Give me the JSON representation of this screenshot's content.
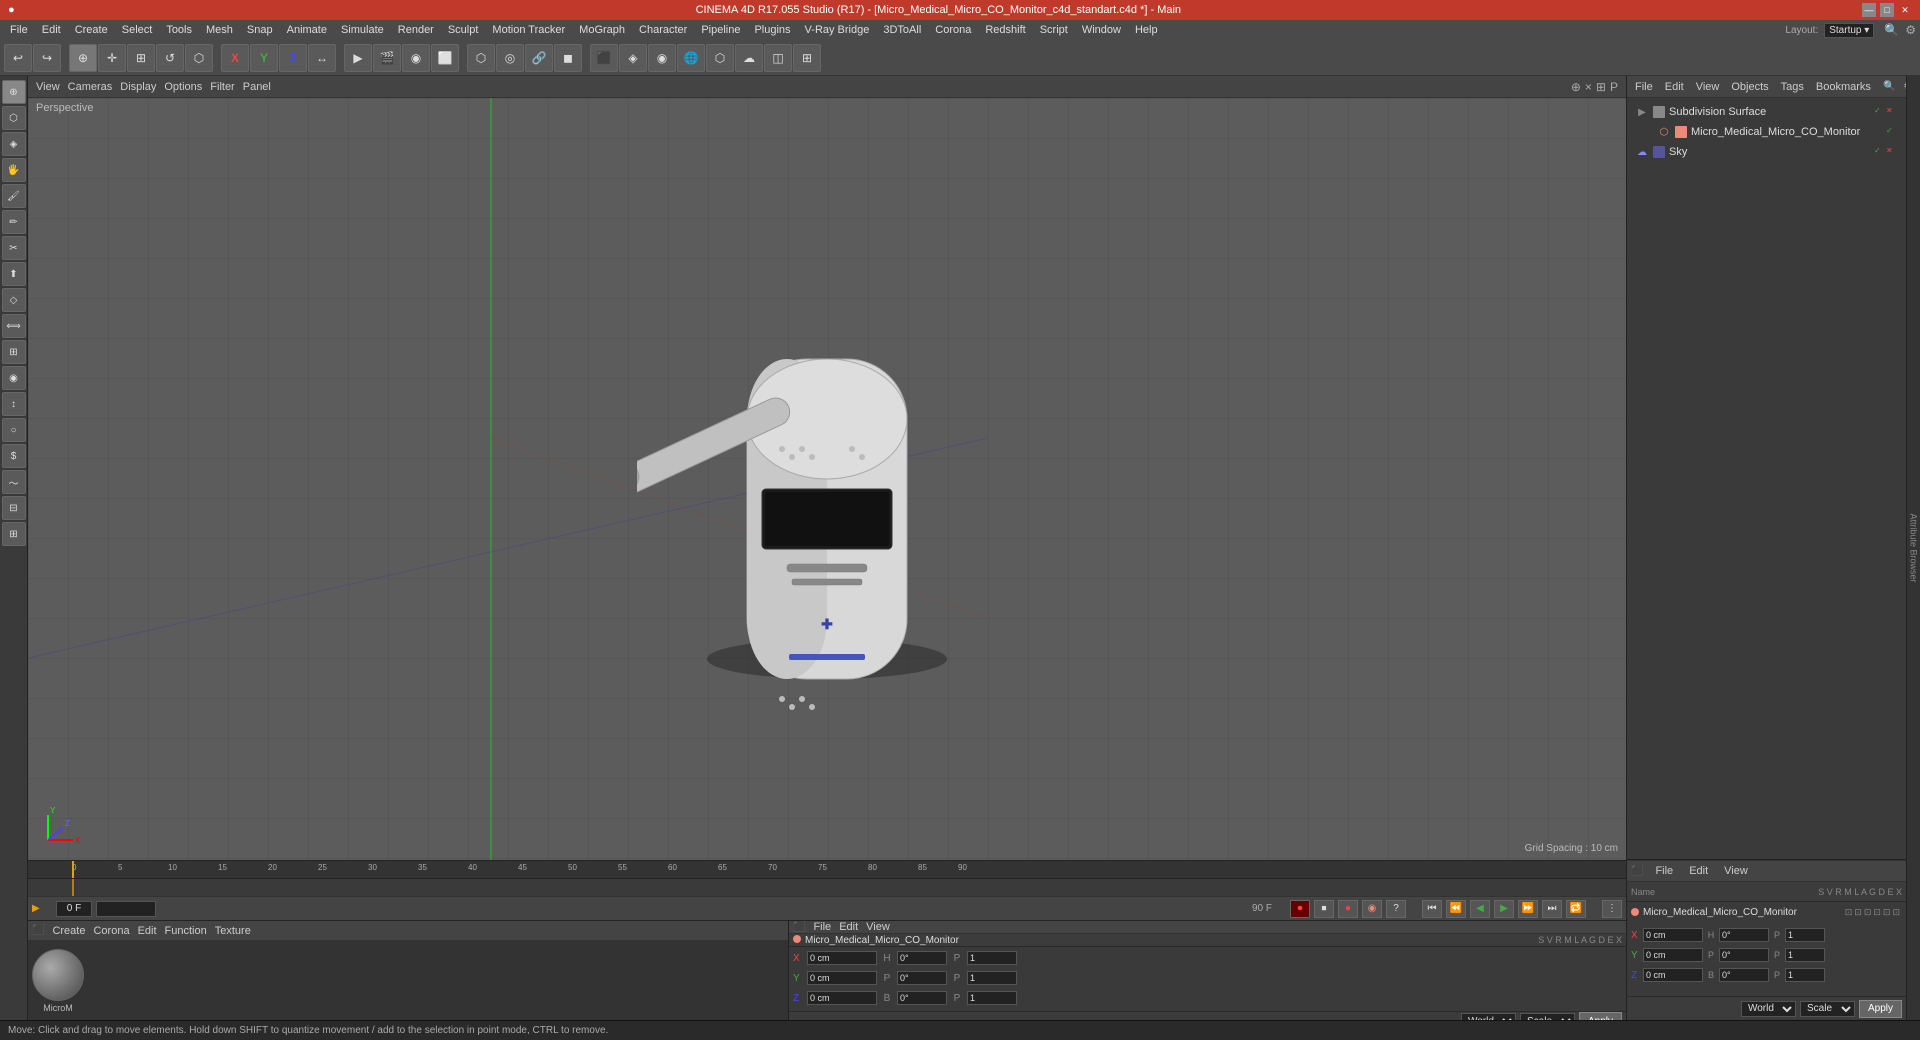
{
  "titleBar": {
    "title": "CINEMA 4D R17.055 Studio (R17) - [Micro_Medical_Micro_CO_Monitor_c4d_standart.c4d *] - Main",
    "minimize": "—",
    "maximize": "□",
    "close": "✕"
  },
  "menuBar": {
    "items": [
      "File",
      "Edit",
      "Create",
      "Select",
      "Tools",
      "Mesh",
      "Snap",
      "Animate",
      "Simulate",
      "Render",
      "Sculpt",
      "Motion Tracker",
      "MoGraph",
      "Character",
      "Pipeline",
      "Plugins",
      "V-Ray Bridge",
      "3DToAll",
      "Corona",
      "Redshift",
      "Script",
      "Window",
      "Help"
    ]
  },
  "toolbar": {
    "layout_label": "Layout:",
    "layout_value": "Startup",
    "groups": [
      {
        "id": "undo",
        "buttons": [
          "↩",
          "↪"
        ]
      },
      {
        "id": "mode",
        "buttons": [
          "⊕",
          "☰",
          "◎",
          "○",
          "⊡",
          "⬡"
        ]
      },
      {
        "id": "transform",
        "buttons": [
          "X",
          "Y",
          "Z",
          "↔"
        ]
      },
      {
        "id": "render",
        "buttons": [
          "▶",
          "🎬",
          "◉",
          "⬜",
          "◼",
          "🔘",
          "⚙",
          "🌐",
          "⬡",
          "◫",
          "⬛"
        ]
      },
      {
        "id": "tools",
        "buttons": [
          "⬡",
          "◎",
          "🌀",
          "⚙",
          "◈",
          "◉",
          "🔲",
          "⬛"
        ]
      }
    ]
  },
  "viewport": {
    "menus": [
      "View",
      "Cameras",
      "Display",
      "Options",
      "Filter",
      "Panel"
    ],
    "perspectiveLabel": "Perspective",
    "gridSpacing": "Grid Spacing : 10 cm",
    "controls": [
      "+",
      "×",
      "⊞",
      "P"
    ]
  },
  "sceneTree": {
    "header_menus": [
      "File",
      "Edit",
      "View",
      "Objects",
      "Tags",
      "Bookmarks"
    ],
    "items": [
      {
        "id": "subdivision",
        "label": "Subdivision Surface",
        "indent": 0,
        "color": "green",
        "checked": true,
        "xmark": true
      },
      {
        "id": "monitor",
        "label": "Micro_Medical_Micro_CO_Monitor",
        "indent": 1,
        "color": "orange",
        "checked": true,
        "xmark": false
      },
      {
        "id": "sky",
        "label": "Sky",
        "indent": 0,
        "color": "blue",
        "checked": true,
        "xmark": true
      }
    ]
  },
  "timeline": {
    "header_menus": [],
    "markers": [
      "0",
      "50",
      "100",
      "150",
      "200",
      "250",
      "300",
      "350",
      "400",
      "450",
      "500",
      "550",
      "600",
      "650",
      "700",
      "750",
      "800",
      "850",
      "900"
    ],
    "ruler_labels": [
      "0",
      "5",
      "10",
      "15",
      "20",
      "25",
      "30",
      "35",
      "40",
      "45",
      "50",
      "55",
      "60",
      "65",
      "70",
      "75",
      "80",
      "85",
      "90"
    ],
    "currentFrame": "0 F",
    "startFrame": "0 F",
    "endFrame": "90 F"
  },
  "transport": {
    "frameStart": "0",
    "frameCurrent": "0",
    "frameEnd": "90",
    "buttons": [
      "⏮",
      "⏪",
      "▶",
      "⏩",
      "⏭",
      "🔁"
    ],
    "recordButtons": [
      "⏺",
      "⏹",
      "●",
      "◉",
      "?",
      "🎬"
    ]
  },
  "materialEditor": {
    "menus": [
      "Create",
      "Corona",
      "Edit",
      "Function",
      "Texture"
    ],
    "materials": [
      {
        "id": "microM",
        "label": "MicroM",
        "color": "#888"
      }
    ]
  },
  "attributes": {
    "header_menus": [
      "File",
      "Edit",
      "View"
    ],
    "objectName": "Micro_Medical_Micro_CO_Monitor",
    "columns": [
      "S",
      "V",
      "R",
      "M",
      "L",
      "A",
      "G",
      "D",
      "E",
      "X"
    ],
    "coords": [
      {
        "axis": "X",
        "pos": "0 cm",
        "rot": "0°"
      },
      {
        "axis": "Y",
        "pos": "0 cm",
        "rot": "0°"
      },
      {
        "axis": "Z",
        "pos": "0 cm",
        "rot": "0°"
      }
    ],
    "posLabel": "P",
    "rotLabel": "B",
    "coordSystem": "World",
    "scaleSystem": "Scale",
    "applyLabel": "Apply"
  },
  "statusBar": {
    "message": "Move: Click and drag to move elements. Hold down SHIFT to quantize movement / add to the selection in point mode, CTRL to remove."
  },
  "rightEdge": {
    "label": "Attribute Browser"
  }
}
